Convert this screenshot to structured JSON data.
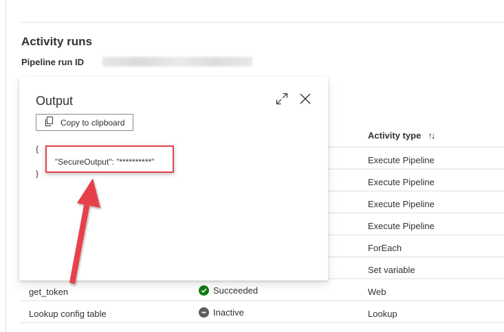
{
  "page": {
    "title": "Activity runs",
    "pipeline_run_id_label": "Pipeline run ID"
  },
  "table": {
    "activity_type_header": "Activity type",
    "rows": [
      {
        "name": "",
        "status": "",
        "type": "Execute Pipeline"
      },
      {
        "name": "",
        "status": "",
        "type": "Execute Pipeline"
      },
      {
        "name": "",
        "status": "",
        "type": "Execute Pipeline"
      },
      {
        "name": "",
        "status": "",
        "type": "Execute Pipeline"
      },
      {
        "name": "",
        "status": "",
        "type": "ForEach"
      },
      {
        "name": "",
        "status": "",
        "type": "Set variable"
      },
      {
        "name": "get_token",
        "status": "Succeeded",
        "type": "Web"
      },
      {
        "name": "Lookup config table",
        "status": "Inactive",
        "type": "Lookup"
      }
    ]
  },
  "output_panel": {
    "title": "Output",
    "copy_button_label": "Copy to clipboard",
    "open_brace": "{",
    "close_brace": "}",
    "json_line": "\"SecureOutput\": \"**********\""
  },
  "colors": {
    "annotation_red": "#e8414b",
    "succeeded_green": "#107c10",
    "inactive_gray": "#605e5c"
  }
}
